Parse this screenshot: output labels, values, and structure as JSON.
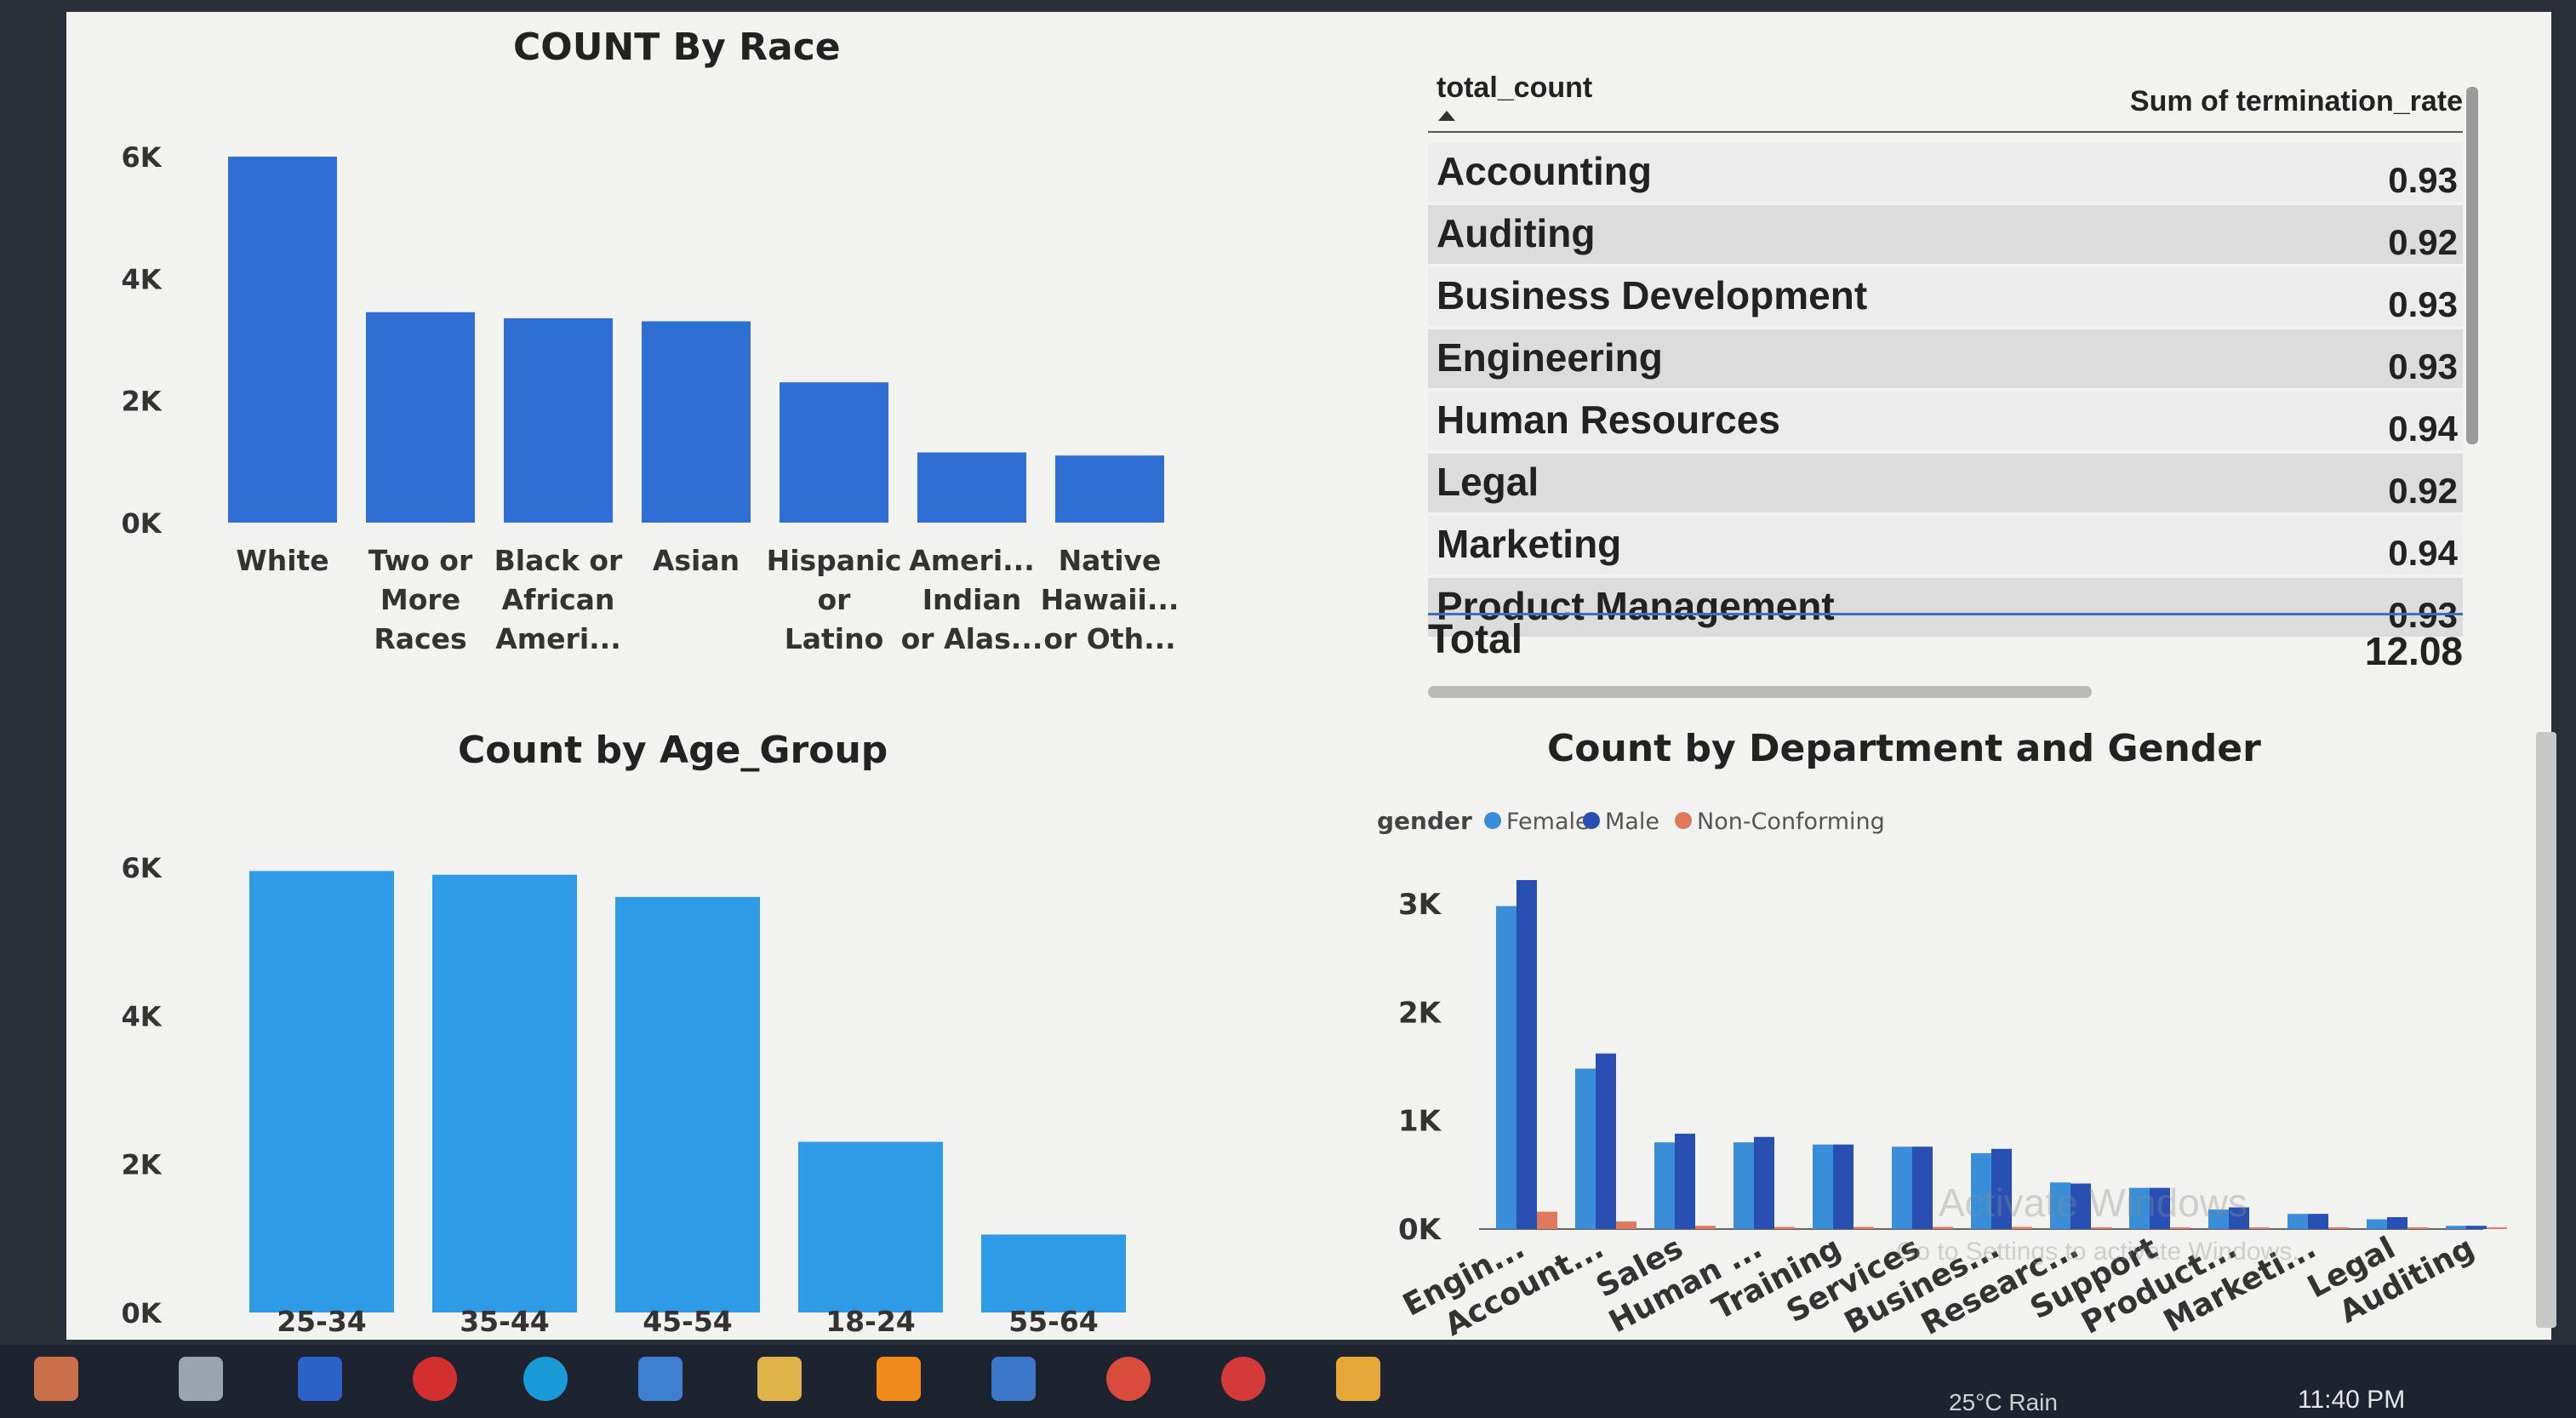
{
  "charts": {
    "race": {
      "title": "COUNT By Race"
    },
    "age": {
      "title": "Count by Age_Group"
    },
    "dept_gender": {
      "title": "Count by Department and Gender"
    }
  },
  "table": {
    "col1": "total_count",
    "col2": "Sum of termination_rate",
    "rows": [
      {
        "name": "Accounting",
        "value": "0.93"
      },
      {
        "name": "Auditing",
        "value": "0.92"
      },
      {
        "name": "Business Development",
        "value": "0.93"
      },
      {
        "name": "Engineering",
        "value": "0.93"
      },
      {
        "name": "Human Resources",
        "value": "0.94"
      },
      {
        "name": "Legal",
        "value": "0.92"
      },
      {
        "name": "Marketing",
        "value": "0.94"
      },
      {
        "name": "Product Management",
        "value": "0.93"
      }
    ],
    "total_label": "Total",
    "total_value": "12.08"
  },
  "taskbar": {
    "clock": "11:40 PM",
    "weather": "25°C Rain",
    "icons": [
      "tools-icon",
      "task-view-icon",
      "word-icon",
      "opera-icon",
      "edge-icon",
      "mail-icon",
      "files-icon",
      "vlc-icon",
      "store-icon",
      "chrome-icon",
      "x-app-icon",
      "chart-app-icon"
    ]
  },
  "watermark": {
    "line1": "Activate Windows",
    "line2": "Go to Settings to activate Windows."
  },
  "colors": {
    "race_bar": "#2f6fd3",
    "age_bar": "#2f9ae6",
    "female": "#3a8ed8",
    "male": "#2a4fb3",
    "nonconforming": "#e07a5f"
  },
  "chart_data": [
    {
      "type": "bar",
      "title": "COUNT By Race",
      "categories": [
        "White",
        "Two or More Races",
        "Black or African Ameri...",
        "Asian",
        "Hispanic or Latino",
        "Ameri... Indian or Alas...",
        "Native Hawaii... or Oth..."
      ],
      "category_lines": [
        [
          "White"
        ],
        [
          "Two or",
          "More",
          "Races"
        ],
        [
          "Black or",
          "African",
          "Ameri..."
        ],
        [
          "Asian"
        ],
        [
          "Hispanic",
          "or",
          "Latino"
        ],
        [
          "Ameri...",
          "Indian",
          "or Alas..."
        ],
        [
          "Native",
          "Hawaii...",
          "or Oth..."
        ]
      ],
      "values": [
        6000,
        3450,
        3350,
        3300,
        2300,
        1150,
        1100
      ],
      "yticks": [
        "0K",
        "2K",
        "4K",
        "6K"
      ],
      "ytick_values": [
        0,
        2000,
        4000,
        6000
      ],
      "ylim": [
        0,
        6000
      ],
      "grid": false
    },
    {
      "type": "bar",
      "title": "Count by Age_Group",
      "categories": [
        "25-34",
        "35-44",
        "45-54",
        "18-24",
        "55-64"
      ],
      "values": [
        5950,
        5900,
        5600,
        2300,
        1050
      ],
      "yticks": [
        "0K",
        "2K",
        "4K",
        "6K"
      ],
      "ytick_values": [
        0,
        2000,
        4000,
        6000
      ],
      "ylim": [
        0,
        6000
      ],
      "grid": false
    },
    {
      "type": "bar",
      "title": "Count by Department and Gender",
      "legend_title": "gender",
      "legend_position": "top-left",
      "categories": [
        "Engin...",
        "Account...",
        "Sales",
        "Human ...",
        "Training",
        "Services",
        "Busines...",
        "Researc...",
        "Support",
        "Product...",
        "Marketi...",
        "Legal",
        "Auditing"
      ],
      "series": [
        {
          "name": "Female",
          "values": [
            2980,
            1480,
            800,
            800,
            780,
            760,
            700,
            430,
            380,
            180,
            140,
            90,
            30
          ]
        },
        {
          "name": "Male",
          "values": [
            3220,
            1620,
            880,
            850,
            780,
            760,
            740,
            420,
            380,
            200,
            140,
            110,
            30
          ]
        },
        {
          "name": "Non-Conforming",
          "values": [
            160,
            70,
            30,
            20,
            20,
            20,
            20,
            10,
            10,
            5,
            5,
            5,
            2
          ]
        }
      ],
      "yticks": [
        "0K",
        "1K",
        "2K",
        "3K"
      ],
      "ytick_values": [
        0,
        1000,
        2000,
        3000
      ],
      "ylim": [
        0,
        3000
      ],
      "grid": false
    }
  ]
}
